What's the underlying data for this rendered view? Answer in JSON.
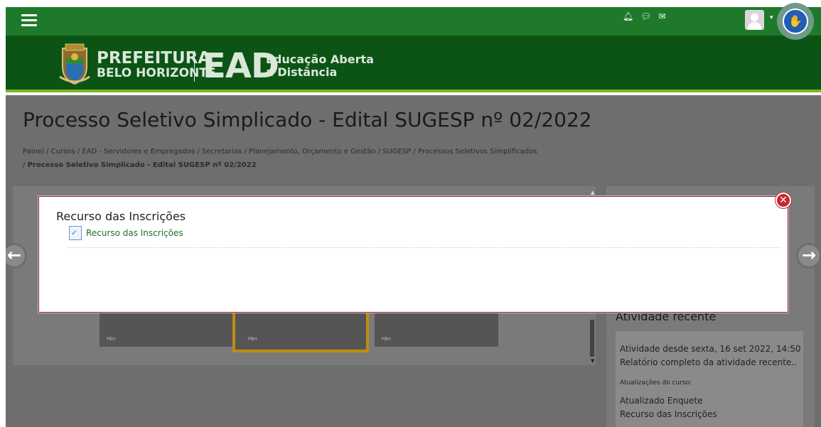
{
  "header": {
    "brand_line1": "PREFEITURA",
    "brand_line2": "BELO HORIZONTE",
    "brand_ead": "EAD",
    "brand_ead_sub1": "Educação Aberta",
    "brand_ead_sub2": "a Distância",
    "top_icons": [
      "bell-icon",
      "chat-bubble-icon",
      "envelope-icon"
    ],
    "user_menu_caret": "▾",
    "a11y_glyph": "✋"
  },
  "page": {
    "title": "Processo Seletivo Simplicado - Edital SUGESP nº 02/2022",
    "breadcrumb": [
      "Painel",
      "Cursos",
      "EAD - Servidores e Empregados",
      "Secretarias",
      "Planejamento, Orçamento e Gestão",
      "SUGESP",
      "Processos Seletivos Simplificados"
    ],
    "breadcrumb_current": "Processo Seletivo Simplicado - Edital SUGESP nº 02/2022",
    "breadcrumb_sep": "/"
  },
  "sidebar": {
    "recent_title": "Atividade recente",
    "recent_since": "Atividade desde sexta, 16 set 2022, 14:50",
    "recent_report": "Relatório completo da atividade recente..",
    "updates_label": "Atualizações do curso:",
    "update_item_1": "Atualizado Enquete",
    "update_item_2": "Recurso das Inscrições"
  },
  "thumbs": [
    "PBH",
    "PBH",
    "PBH"
  ],
  "modal": {
    "title": "Recurso das Inscrições",
    "link_label": "Recurso das Inscrições",
    "close_glyph": "✕"
  },
  "nav": {
    "prev_glyph": "←",
    "next_glyph": "→"
  },
  "colors": {
    "topbar": "#1e7a2a",
    "brandbar": "#0c5416",
    "accent_line": "#7ab51d",
    "modal_border": "#a01e2c",
    "close_button": "#c62834",
    "link_green": "#1e6f26"
  }
}
